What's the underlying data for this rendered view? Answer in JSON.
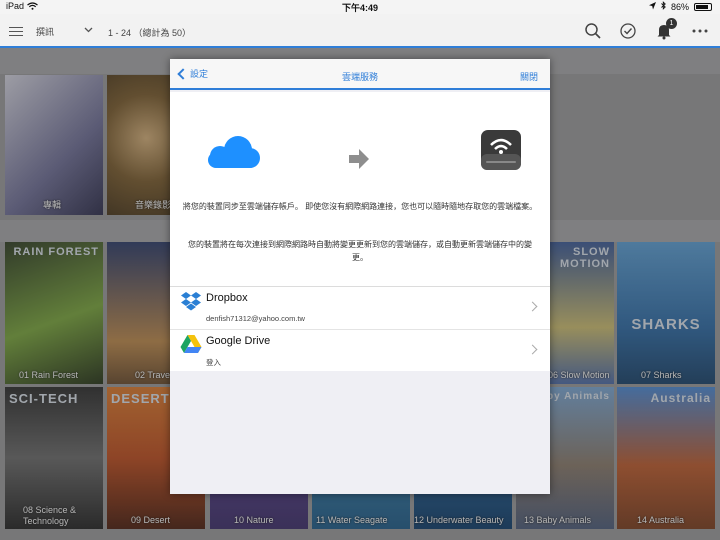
{
  "statusbar": {
    "device": "iPad",
    "time": "下午4:49",
    "battery": "86%",
    "battery_level": 0.86
  },
  "toolbar": {
    "category": "撰訊",
    "range": "1 - 24 （總計為 50）",
    "notification_count": "1"
  },
  "background": {
    "top_tiles": [
      {
        "label": "專輯"
      },
      {
        "label": "音樂錄影"
      }
    ],
    "middle_tiles": [
      {
        "label": "01 Rain Forest",
        "art": "RAIN FOREST"
      },
      {
        "label": "02 Travel",
        "art": ""
      },
      {
        "label": "",
        "art": ""
      },
      {
        "label": "",
        "art": ""
      },
      {
        "label": "",
        "art": ""
      },
      {
        "label": "06 Slow Motion",
        "art": "SLOW MOTION"
      },
      {
        "label": "07 Sharks",
        "art": "SHARKS"
      }
    ],
    "bottom_tiles": [
      {
        "label": "08 Science & Technology",
        "art": "SCI-TECH"
      },
      {
        "label": "09 Desert",
        "art": "DESERT"
      },
      {
        "label": "10 Nature",
        "art": ""
      },
      {
        "label": "11 Water Seagate",
        "art": ""
      },
      {
        "label": "12 Underwater Beauty",
        "art": ""
      },
      {
        "label": "13 Baby Animals",
        "art": "Baby Animals"
      },
      {
        "label": "14 Australia",
        "art": "Australia"
      }
    ]
  },
  "modal": {
    "back_label": "設定",
    "title": "雲端服務",
    "close_label": "關閉",
    "description_1": "將您的裝置同步至雲端儲存帳戶。 即使您沒有網際網路連接，您也可以隨時隨地存取您的雲端檔案。",
    "description_2": "您的裝置將在每次連接到網際網路時自動將變更更新到您的雲端儲存，或自動更新雲端儲存中的變更。",
    "services": [
      {
        "name": "Dropbox",
        "detail": "denfish71312@yahoo.com.tw"
      },
      {
        "name": "Google Drive",
        "detail": "登入"
      }
    ]
  },
  "colors": {
    "accent": "#2f7ed8",
    "cloud": "#1e90ff",
    "dropbox": "#2a7fd4"
  }
}
